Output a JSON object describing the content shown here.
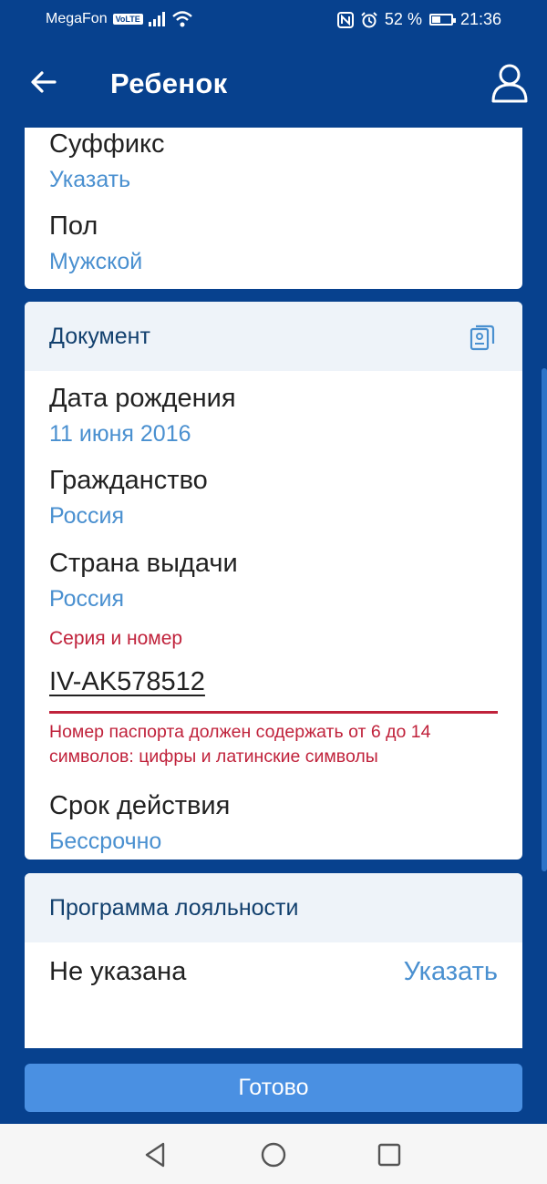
{
  "status_bar": {
    "carrier": "MegaFon",
    "volte": "VoLTE",
    "battery_percent": "52 %",
    "battery_level": 0.52,
    "time": "21:36"
  },
  "app_bar": {
    "title": "Ребенок",
    "back_icon": "arrow-left-icon",
    "profile_icon": "user-icon"
  },
  "personal": {
    "suffix": {
      "label": "Суффикс",
      "value": "Указать"
    },
    "gender": {
      "label": "Пол",
      "value": "Мужской"
    }
  },
  "document": {
    "title": "Документ",
    "icon": "passport-icon",
    "birth_date": {
      "label": "Дата рождения",
      "value": "11 июня 2016"
    },
    "citizenship": {
      "label": "Гражданство",
      "value": "Россия"
    },
    "issuing_country": {
      "label": "Страна выдачи",
      "value": "Россия"
    },
    "series_number": {
      "label": "Серия и номер",
      "value": "IV-AK578512",
      "error": "Номер паспорта должен содержать от 6 до 14 символов: цифры и латинские символы"
    },
    "validity": {
      "label": "Срок действия",
      "value": "Бессрочно"
    }
  },
  "loyalty": {
    "title": "Программа лояльности",
    "status": "Не указана",
    "action": "Указать"
  },
  "done_button": "Готово",
  "colors": {
    "background": "#07418E",
    "accent": "#4A90E2",
    "link": "#4A90D0",
    "error": "#C0223B"
  }
}
